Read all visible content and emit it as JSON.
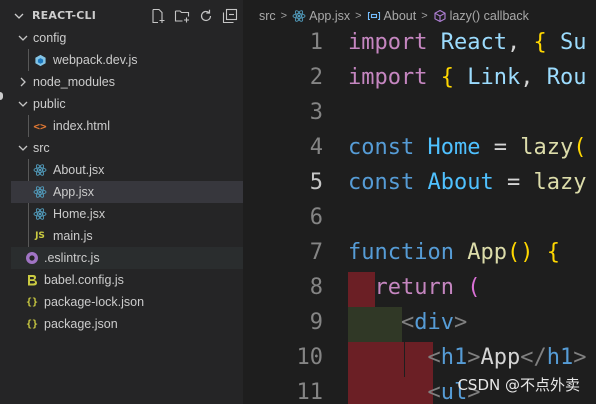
{
  "explorer": {
    "title": "REACT-CLI",
    "actions": [
      "new-file-icon",
      "new-folder-icon",
      "refresh-icon",
      "collapse-all-icon"
    ],
    "tree": [
      {
        "label": "config",
        "type": "folder",
        "expanded": true
      },
      {
        "label": "webpack.dev.js",
        "type": "file",
        "icon": "webpack-icon"
      },
      {
        "label": "node_modules",
        "type": "folder",
        "expanded": false
      },
      {
        "label": "public",
        "type": "folder",
        "expanded": true
      },
      {
        "label": "index.html",
        "type": "file",
        "icon": "html-icon"
      },
      {
        "label": "src",
        "type": "folder",
        "expanded": true
      },
      {
        "label": "About.jsx",
        "type": "file",
        "icon": "react-icon"
      },
      {
        "label": "App.jsx",
        "type": "file",
        "icon": "react-icon",
        "selected": true
      },
      {
        "label": "Home.jsx",
        "type": "file",
        "icon": "react-icon"
      },
      {
        "label": "main.js",
        "type": "file",
        "icon": "js-icon",
        "glyph": "JS"
      },
      {
        "label": ".eslintrc.js",
        "type": "file",
        "icon": "eslint-icon"
      },
      {
        "label": "babel.config.js",
        "type": "file",
        "icon": "babel-icon"
      },
      {
        "label": "package-lock.json",
        "type": "file",
        "icon": "json-icon",
        "glyph": "{}"
      },
      {
        "label": "package.json",
        "type": "file",
        "icon": "json-icon",
        "glyph": "{}"
      }
    ],
    "html_glyph": "<>"
  },
  "breadcrumb": {
    "items": [
      "src",
      "App.jsx",
      "About",
      "lazy() callback"
    ],
    "separator": ">"
  },
  "editor": {
    "active_line": "5",
    "lines": [
      {
        "n": "1",
        "tokens": [
          [
            "import",
            "kw-import"
          ],
          [
            " ",
            ""
          ],
          [
            "React",
            "var"
          ],
          [
            ", ",
            ""
          ],
          [
            "{",
            "brace"
          ],
          [
            " Su",
            "var"
          ]
        ]
      },
      {
        "n": "2",
        "tokens": [
          [
            "import",
            "kw-import"
          ],
          [
            " ",
            ""
          ],
          [
            "{",
            "brace"
          ],
          [
            " ",
            ""
          ],
          [
            "Link",
            "var"
          ],
          [
            ", ",
            ""
          ],
          [
            "Rou",
            "var"
          ]
        ]
      },
      {
        "n": "3",
        "tokens": []
      },
      {
        "n": "4",
        "tokens": [
          [
            "const",
            "kw"
          ],
          [
            " ",
            ""
          ],
          [
            "Home",
            "ident"
          ],
          [
            " = ",
            ""
          ],
          [
            "lazy",
            "fn"
          ],
          [
            "(",
            "brace"
          ]
        ]
      },
      {
        "n": "5",
        "tokens": [
          [
            "const",
            "kw"
          ],
          [
            " ",
            ""
          ],
          [
            "About",
            "ident"
          ],
          [
            " = ",
            ""
          ],
          [
            "lazy",
            "fn"
          ]
        ]
      },
      {
        "n": "6",
        "tokens": []
      },
      {
        "n": "7",
        "tokens": [
          [
            "function",
            "kw"
          ],
          [
            " ",
            ""
          ],
          [
            "App",
            "fn"
          ],
          [
            "()",
            "brace"
          ],
          [
            " ",
            ""
          ],
          [
            "{",
            "brace"
          ]
        ]
      },
      {
        "n": "8",
        "tokens": [
          [
            "  ",
            ""
          ],
          [
            "return",
            "kw-import"
          ],
          [
            " ",
            ""
          ],
          [
            "(",
            "paren2"
          ]
        ]
      },
      {
        "n": "9",
        "tokens": [
          [
            "    ",
            ""
          ],
          [
            "<",
            "punct"
          ],
          [
            "div",
            "tag"
          ],
          [
            ">",
            "punct"
          ]
        ]
      },
      {
        "n": "10",
        "tokens": [
          [
            "      ",
            ""
          ],
          [
            "<",
            "punct"
          ],
          [
            "h1",
            "tag"
          ],
          [
            ">",
            "punct"
          ],
          [
            "App",
            ""
          ],
          [
            "</",
            "punct"
          ],
          [
            "h1",
            "tag"
          ],
          [
            ">",
            "punct"
          ]
        ]
      },
      {
        "n": "11",
        "tokens": [
          [
            "      ",
            ""
          ],
          [
            "<",
            "punct"
          ],
          [
            "ul",
            "tag"
          ],
          [
            ">",
            "punct"
          ]
        ]
      }
    ]
  },
  "watermark": "CSDN @不点外卖",
  "colors": {
    "sidebar_bg": "#252526",
    "editor_bg": "#1e1e1e",
    "selection": "#37373d",
    "indent_error_red": "#6b1f25",
    "indent_warn": "#303826"
  }
}
